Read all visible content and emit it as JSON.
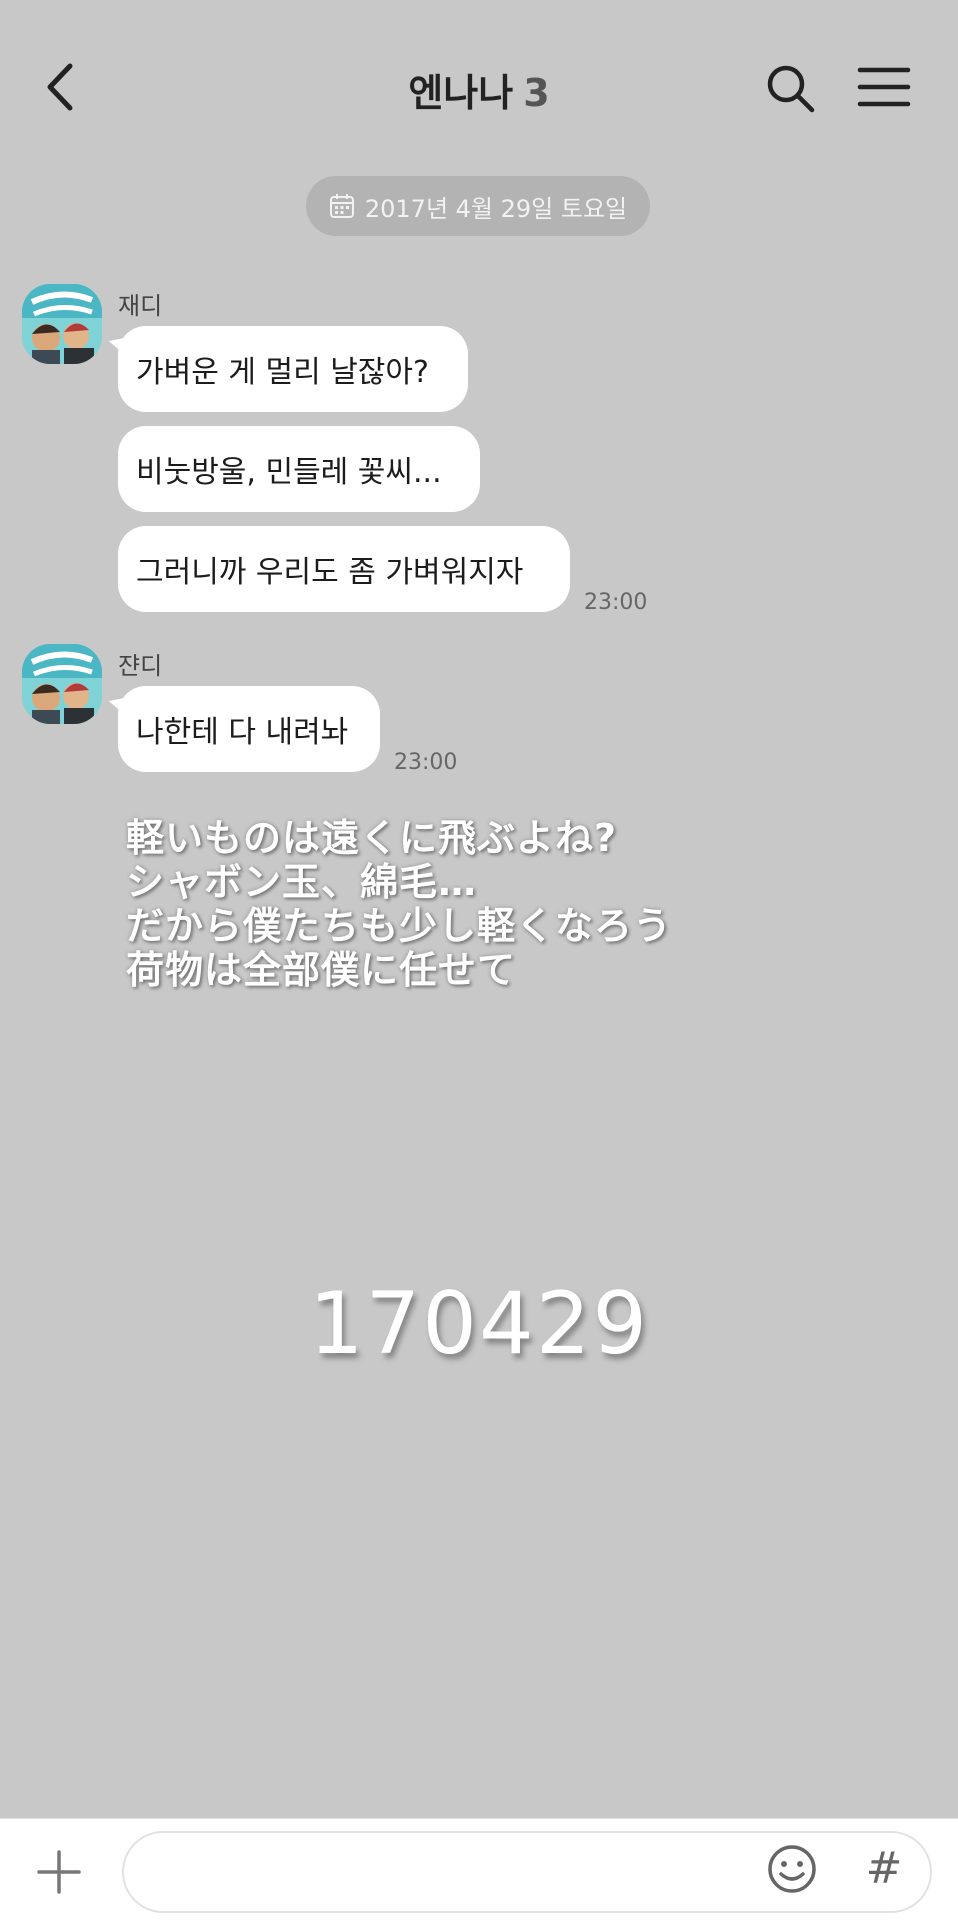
{
  "header": {
    "title": "엔나나",
    "member_count": "3",
    "back_icon": "chevron-left-icon",
    "search_icon": "search-icon",
    "menu_icon": "hamburger-menu-icon"
  },
  "date_divider": {
    "icon": "calendar-icon",
    "label": "2017년 4월 29일 토요일"
  },
  "messages": [
    {
      "sender": "재디",
      "bubbles": [
        "가벼운 게 멀리 날잖아?",
        "비눗방울, 민들레 꽃씨...",
        "그러니까 우리도 좀 가벼워지자"
      ],
      "time": "23:00"
    },
    {
      "sender": "쟌디",
      "bubbles": [
        "나한테 다 내려놔"
      ],
      "time": "23:00"
    }
  ],
  "overlay": {
    "lyrics": [
      "軽いものは遠くに飛ぶよね?",
      "シャボン玉、綿毛…",
      "だから僕たちも少し軽くなろう",
      "荷物は全部僕に任せて"
    ],
    "date_code": "170429"
  },
  "input_bar": {
    "plus_icon": "plus-icon",
    "emoji_icon": "emoji-icon",
    "hash_label": "#"
  }
}
